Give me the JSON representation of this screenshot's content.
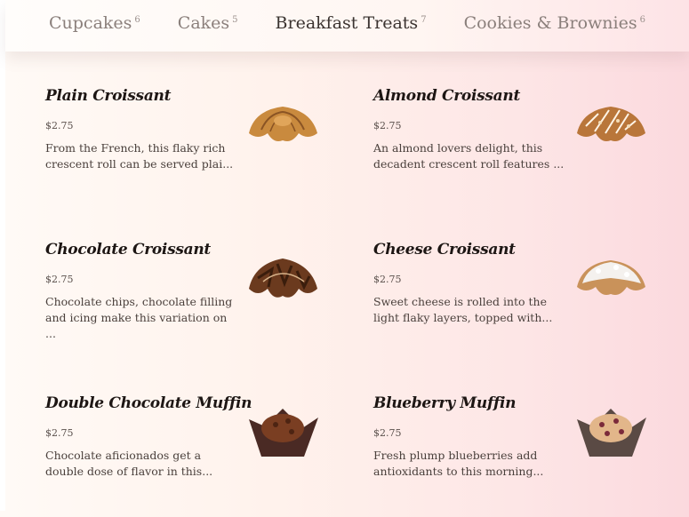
{
  "tabs": [
    {
      "label": "Cupcakes",
      "count": "6"
    },
    {
      "label": "Cakes",
      "count": "5"
    },
    {
      "label": "Breakfast Treats",
      "count": "7"
    },
    {
      "label": "Cookies & Brownies",
      "count": "6"
    }
  ],
  "items": [
    {
      "name": "Plain Croissant",
      "price": "$2.75",
      "desc": "From the French, this flaky rich crescent roll  can be served plai...",
      "icon": "plain-croissant-image"
    },
    {
      "name": "Almond Croissant",
      "price": "$2.75",
      "desc": "An almond lovers delight, this decadent crescent roll features ...",
      "icon": "almond-croissant-image"
    },
    {
      "name": "Chocolate Croissant",
      "price": "$2.75",
      "desc": "Chocolate chips, chocolate filling and icing make this variation on ...",
      "icon": "chocolate-croissant-image"
    },
    {
      "name": "Cheese Croissant",
      "price": "$2.75",
      "desc": "Sweet cheese is rolled into the light flaky layers, topped with...",
      "icon": "cheese-croissant-image"
    },
    {
      "name": "Double Chocolate Muffin",
      "price": "$2.75",
      "desc": "Chocolate aficionados get a double dose of flavor in this...",
      "icon": "double-chocolate-muffin-image"
    },
    {
      "name": "Blueberry Muffin",
      "price": "$2.75",
      "desc": "Fresh plump blueberries add antioxidants to this morning...",
      "icon": "blueberry-muffin-image"
    }
  ]
}
